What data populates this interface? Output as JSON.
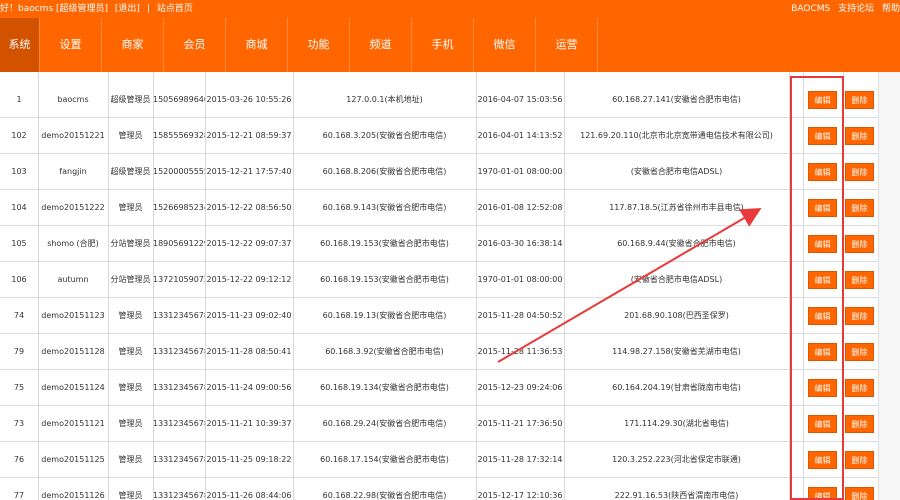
{
  "topbar": {
    "greeting": "好！baocms [超级管理员]",
    "logout": "[退出]",
    "site_home": "站点首页",
    "brand": "BAOCMS",
    "support": "支持论坛",
    "help": "帮助"
  },
  "nav": [
    "系统",
    "设置",
    "商家",
    "会员",
    "商城",
    "功能",
    "频道",
    "手机",
    "微信",
    "运营"
  ],
  "buttons": {
    "edit": "编辑",
    "delete": "删除"
  },
  "rows": [
    {
      "id": "1",
      "user": "baocms",
      "role": "超级管理员",
      "phone": "15056989640",
      "created": "2015-03-26 10:55:26",
      "ip": "127.0.0.1(本机地址)",
      "last": "2016-04-07 15:03:56",
      "last_ip": "60.168.27.141(安徽省合肥市电信)"
    },
    {
      "id": "102",
      "user": "demo20151221",
      "role": "管理员",
      "phone": "15855569328",
      "created": "2015-12-21 08:59:37",
      "ip": "60.168.3.205(安徽省合肥市电信)",
      "last": "2016-04-01 14:13:52",
      "last_ip": "121.69.20.110(北京市北京宽带通电信技术有限公司)"
    },
    {
      "id": "103",
      "user": "fangjin",
      "role": "超级管理员",
      "phone": "15200005555",
      "created": "2015-12-21 17:57:40",
      "ip": "60.168.8.206(安徽省合肥市电信)",
      "last": "1970-01-01 08:00:00",
      "last_ip": "(安徽省合肥市电信ADSL)"
    },
    {
      "id": "104",
      "user": "demo20151222",
      "role": "管理员",
      "phone": "15266985234",
      "created": "2015-12-22 08:56:50",
      "ip": "60.168.9.143(安徽省合肥市电信)",
      "last": "2016-01-08 12:52:08",
      "last_ip": "117.87.18.5(江苏省徐州市丰县电信)"
    },
    {
      "id": "105",
      "user": "shomo (合肥)",
      "role": "分站管理员",
      "phone": "18905691229",
      "created": "2015-12-22 09:07:37",
      "ip": "60.168.19.153(安徽省合肥市电信)",
      "last": "2016-03-30 16:38:14",
      "last_ip": "60.168.9.44(安徽省合肥市电信)"
    },
    {
      "id": "106",
      "user": "autumn",
      "role": "分站管理员",
      "phone": "13721059072",
      "created": "2015-12-22 09:12:12",
      "ip": "60.168.19.153(安徽省合肥市电信)",
      "last": "1970-01-01 08:00:00",
      "last_ip": "(安徽省合肥市电信ADSL)"
    },
    {
      "id": "74",
      "user": "demo20151123",
      "role": "管理员",
      "phone": "13312345678",
      "created": "2015-11-23 09:02:40",
      "ip": "60.168.19.13(安徽省合肥市电信)",
      "last": "2015-11-28 04:50:52",
      "last_ip": "201.68.90.108(巴西圣保罗)"
    },
    {
      "id": "79",
      "user": "demo20151128",
      "role": "管理员",
      "phone": "13312345678",
      "created": "2015-11-28 08:50:41",
      "ip": "60.168.3.92(安徽省合肥市电信)",
      "last": "2015-11-28 11:36:53",
      "last_ip": "114.98.27.158(安徽省芜湖市电信)"
    },
    {
      "id": "75",
      "user": "demo20151124",
      "role": "管理员",
      "phone": "13312345678",
      "created": "2015-11-24 09:00:56",
      "ip": "60.168.19.134(安徽省合肥市电信)",
      "last": "2015-12-23 09:24:06",
      "last_ip": "60.164.204.19(甘肃省陇南市电信)"
    },
    {
      "id": "73",
      "user": "demo20151121",
      "role": "管理员",
      "phone": "13312345678",
      "created": "2015-11-21 10:39:37",
      "ip": "60.168.29.24(安徽省合肥市电信)",
      "last": "2015-11-21 17:36:50",
      "last_ip": "171.114.29.30(湖北省电信)"
    },
    {
      "id": "76",
      "user": "demo20151125",
      "role": "管理员",
      "phone": "13312345678",
      "created": "2015-11-25 09:18:22",
      "ip": "60.168.17.154(安徽省合肥市电信)",
      "last": "2015-11-28 17:32:14",
      "last_ip": "120.3.252.223(河北省保定市联通)"
    },
    {
      "id": "77",
      "user": "demo20151126",
      "role": "管理员",
      "phone": "13312345678",
      "created": "2015-11-26 08:44:06",
      "ip": "60.168.22.98(安徽省合肥市电信)",
      "last": "2015-12-17 12:10:36",
      "last_ip": "222.91.16.53(陕西省渭南市电信)"
    }
  ],
  "colors": {
    "accent": "#ff6600",
    "nav_active": "#d25200",
    "highlight": "#e83a3a"
  }
}
